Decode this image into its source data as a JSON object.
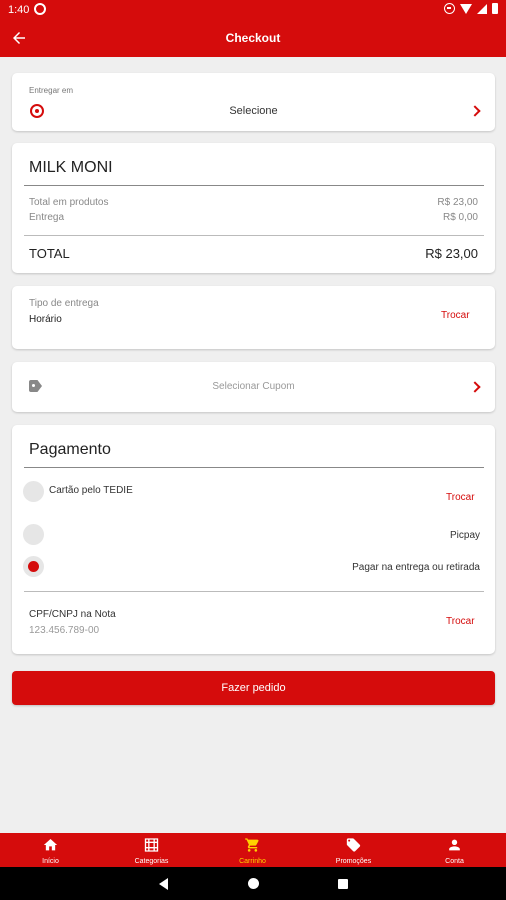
{
  "status_bar": {
    "time": "1:40"
  },
  "app_bar": {
    "title": "Checkout"
  },
  "delivery_address": {
    "label": "Entregar em",
    "value": "Selecione"
  },
  "store": {
    "name": "MILK MONI",
    "rows": [
      {
        "label": "Total em produtos",
        "value": "R$ 23,00"
      },
      {
        "label": "Entrega",
        "value": "R$ 0,00"
      }
    ],
    "total_label": "TOTAL",
    "total_value": "R$ 23,00"
  },
  "delivery_type": {
    "label": "Tipo de entrega",
    "value": "Horário",
    "action": "Trocar"
  },
  "coupon": {
    "label": "Selecionar Cupom"
  },
  "payment": {
    "title": "Pagamento",
    "options": [
      {
        "label": "Cartão pelo TEDIE",
        "action": "Trocar",
        "selected": false
      },
      {
        "label": "Picpay",
        "selected": false
      },
      {
        "label": "Pagar na entrega ou retirada",
        "selected": true
      }
    ],
    "cpf_label": "CPF/CNPJ na Nota",
    "cpf_value": "123.456.789-00",
    "cpf_action": "Trocar"
  },
  "order_button": "Fazer pedido",
  "bottom_nav": [
    {
      "label": "Início",
      "icon": "home-icon",
      "active": false
    },
    {
      "label": "Categorias",
      "icon": "grid-icon",
      "active": false
    },
    {
      "label": "Carrinho",
      "icon": "cart-icon",
      "active": true
    },
    {
      "label": "Promoções",
      "icon": "tag-icon",
      "active": false
    },
    {
      "label": "Conta",
      "icon": "person-icon",
      "active": false
    }
  ],
  "colors": {
    "primary": "#d50c0c",
    "active_nav": "#ffd200",
    "background": "#efefef"
  }
}
